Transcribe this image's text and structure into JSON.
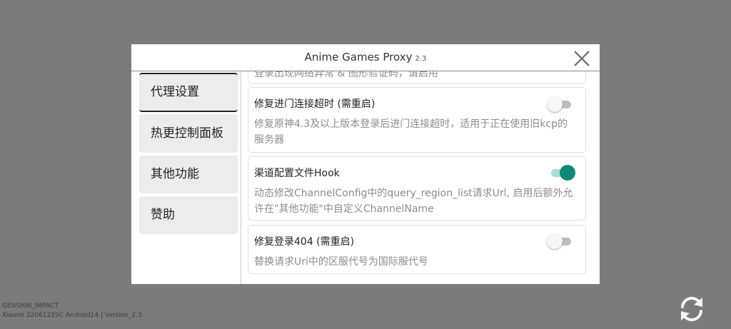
{
  "dialog": {
    "title": "Anime Games Proxy",
    "version": "2.3"
  },
  "sidebar": {
    "items": [
      {
        "label": "代理设置"
      },
      {
        "label": "热更控制面板"
      },
      {
        "label": "其他功能"
      },
      {
        "label": "赞助"
      }
    ]
  },
  "content": {
    "cut_off_text": "登录出现网络异常 & 图形验证码，请启用",
    "items": [
      {
        "title": "修复进门连接超时 (需重启)",
        "description": "修复原神4.3及以上版本登录后进门连接超时，适用于正在使用旧kcp的服务器",
        "enabled": false
      },
      {
        "title": "渠道配置文件Hook",
        "description": "动态修改ChannelConfig中的query_region_list请求Url, 启用后额外允许在\"其他功能\"中自定义ChannelName",
        "enabled": true
      },
      {
        "title": "修复登录404 (需重启)",
        "description": "替换请求Uri中的区服代号为国际服代号",
        "enabled": false
      }
    ]
  },
  "footer": {
    "game": "GENSHIN_IMPACT",
    "device_info": "Xiaomi 2206122SC Android14 | Version_2.3"
  },
  "colors": {
    "background": "#7b7b7b",
    "accent": "#0e8a76",
    "accent_track": "#a8ddd6"
  },
  "icons": {
    "close": "close-icon",
    "refresh": "refresh-icon"
  }
}
